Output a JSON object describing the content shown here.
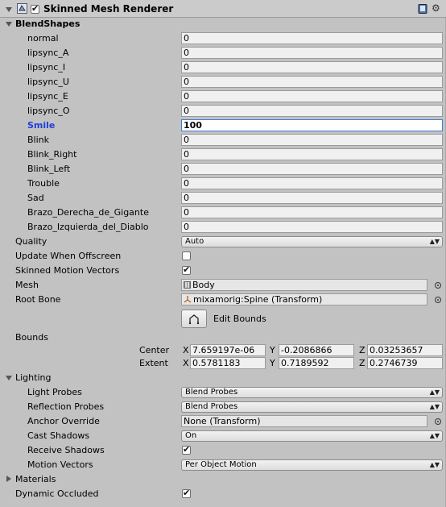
{
  "component": {
    "title": "Skinned Mesh Renderer",
    "enabled": true,
    "book_icon": "help-book-icon",
    "gear_icon": "gear-icon"
  },
  "blendshapes": {
    "title": "BlendShapes",
    "items": [
      {
        "name": "normal",
        "value": "0"
      },
      {
        "name": "lipsync_A",
        "value": "0"
      },
      {
        "name": "lipsync_I",
        "value": "0"
      },
      {
        "name": "lipsync_U",
        "value": "0"
      },
      {
        "name": "lipsync_E",
        "value": "0"
      },
      {
        "name": "lipsync_O",
        "value": "0"
      },
      {
        "name": "Smile",
        "value": "100"
      },
      {
        "name": "Blink",
        "value": "0"
      },
      {
        "name": "Blink_Right",
        "value": "0"
      },
      {
        "name": "Blink_Left",
        "value": "0"
      },
      {
        "name": "Trouble",
        "value": "0"
      },
      {
        "name": "Sad",
        "value": "0"
      },
      {
        "name": "Brazo_Derecha_de_Gigante",
        "value": "0"
      },
      {
        "name": "Brazo_Izquierda_del_Diablo",
        "value": "0"
      }
    ]
  },
  "quality": {
    "label": "Quality",
    "value": "Auto"
  },
  "update_offscreen": {
    "label": "Update When Offscreen",
    "checked": false
  },
  "skinned_motion": {
    "label": "Skinned Motion Vectors",
    "checked": true
  },
  "mesh": {
    "label": "Mesh",
    "value": "Body"
  },
  "root_bone": {
    "label": "Root Bone",
    "value": "mixamorig:Spine (Transform)"
  },
  "edit_bounds": {
    "label": "Edit Bounds"
  },
  "bounds": {
    "label": "Bounds",
    "center": {
      "label": "Center",
      "x": "7.659197e-06",
      "y": "-0.2086866",
      "z": "0.03253657"
    },
    "extent": {
      "label": "Extent",
      "x": "0.5781183",
      "y": "0.7189592",
      "z": "0.2746739"
    },
    "axis_x": "X",
    "axis_y": "Y",
    "axis_z": "Z"
  },
  "lighting": {
    "title": "Lighting",
    "light_probes": {
      "label": "Light Probes",
      "value": "Blend Probes"
    },
    "reflection_probes": {
      "label": "Reflection Probes",
      "value": "Blend Probes"
    },
    "anchor_override": {
      "label": "Anchor Override",
      "value": "None (Transform)"
    },
    "cast_shadows": {
      "label": "Cast Shadows",
      "value": "On"
    },
    "receive_shadows": {
      "label": "Receive Shadows",
      "checked": true
    },
    "motion_vectors": {
      "label": "Motion Vectors",
      "value": "Per Object Motion"
    }
  },
  "materials": {
    "title": "Materials"
  },
  "dynamic_occluded": {
    "label": "Dynamic Occluded",
    "checked": true
  }
}
